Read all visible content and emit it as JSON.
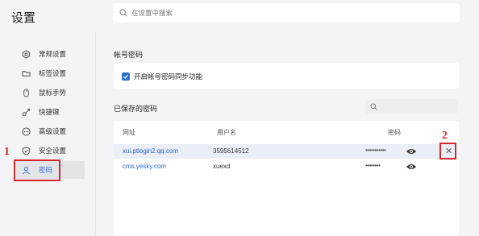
{
  "header": {
    "title": "设置",
    "search_placeholder": "在设置中搜索"
  },
  "sidebar": {
    "items": [
      {
        "label": "常规设置",
        "icon": "gear-icon"
      },
      {
        "label": "标签设置",
        "icon": "tab-icon"
      },
      {
        "label": "鼠标手势",
        "icon": "mouse-icon"
      },
      {
        "label": "快捷键",
        "icon": "shortcut-icon"
      },
      {
        "label": "高级设置",
        "icon": "more-icon"
      },
      {
        "label": "安全设置",
        "icon": "shield-icon"
      },
      {
        "label": "密码",
        "icon": "user-icon",
        "active": true
      }
    ]
  },
  "main": {
    "account_section_title": "帐号密码",
    "sync_label": "开启帐号密码同步功能",
    "sync_checked": true,
    "saved_section_title": "已保存的密码",
    "table": {
      "headers": [
        "网址",
        "用户名",
        "密码"
      ],
      "rows": [
        {
          "url": "xui.ptlogin2.qq.com",
          "username": "3595614512",
          "password": "•••••••••••",
          "selected": true
        },
        {
          "url": "cms.yesky.com",
          "username": "xuexd",
          "password": "••••••••"
        }
      ]
    },
    "delete_symbol": "✕"
  },
  "annotations": {
    "label_1": "1",
    "label_2": "2",
    "color": "#d7262b"
  },
  "colors": {
    "accent": "#2c6ecb",
    "link": "#2d62c4",
    "annotation": "#d7262b"
  }
}
